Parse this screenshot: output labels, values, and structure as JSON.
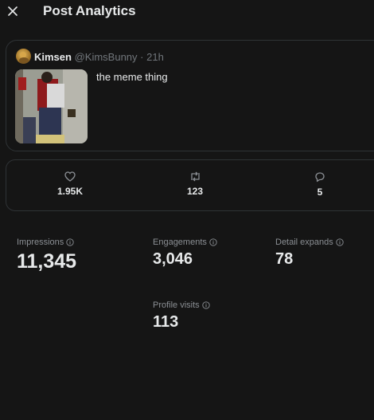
{
  "header": {
    "title": "Post Analytics",
    "close_icon": "close-icon"
  },
  "tweet": {
    "display_name": "Kimsen",
    "handle": "@KimsBunny",
    "separator": "·",
    "time": "21h",
    "text": "the meme thing",
    "media_icon": "image-thumbnail"
  },
  "engagement": {
    "likes": {
      "icon": "heart-icon",
      "value": "1.95K"
    },
    "reposts": {
      "icon": "repost-icon",
      "value": "123"
    },
    "replies": {
      "icon": "reply-icon",
      "value": "5"
    }
  },
  "metrics": {
    "impressions": {
      "label": "Impressions",
      "value": "11,345"
    },
    "engagements": {
      "label": "Engagements",
      "value": "3,046"
    },
    "detail_expands": {
      "label": "Detail expands",
      "value": "78"
    },
    "profile_visits": {
      "label": "Profile visits",
      "value": "113"
    }
  },
  "colors": {
    "background": "#151515",
    "border": "#2f3336",
    "text_primary": "#e7e9ea",
    "text_secondary": "#71767b"
  }
}
